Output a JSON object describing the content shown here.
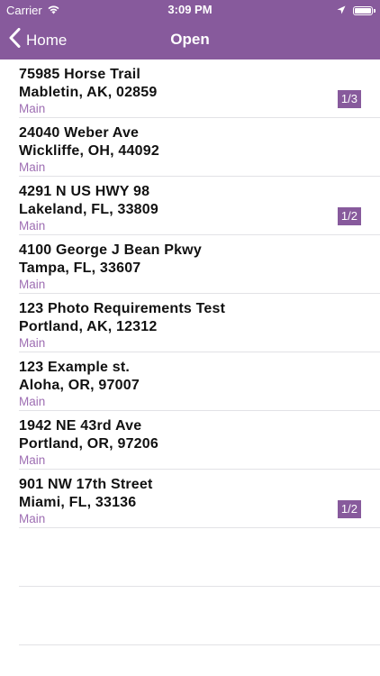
{
  "status_bar": {
    "carrier": "Carrier",
    "time": "3:09 PM",
    "wifi_icon": "wifi-icon",
    "location_icon": "location-arrow-icon",
    "battery_icon": "battery-icon",
    "battery_level": 1.0
  },
  "nav": {
    "back_label": "Home",
    "back_icon": "chevron-left-icon",
    "title": "Open"
  },
  "colors": {
    "header_bg": "#875a9c",
    "accent": "#9e6eb3",
    "badge_bg": "#875a9c"
  },
  "items": [
    {
      "line1": "75985 Horse Trail",
      "line2": "Mabletin, AK, 02859",
      "type": "Main",
      "badge": "1/3"
    },
    {
      "line1": "24040 Weber Ave",
      "line2": "Wickliffe, OH, 44092",
      "type": "Main",
      "badge": ""
    },
    {
      "line1": "4291 N US HWY 98",
      "line2": "Lakeland, FL, 33809",
      "type": "Main",
      "badge": "1/2"
    },
    {
      "line1": "4100 George J Bean Pkwy",
      "line2": "Tampa, FL, 33607",
      "type": "Main",
      "badge": ""
    },
    {
      "line1": "123 Photo Requirements Test",
      "line2": "Portland, AK, 12312",
      "type": "Main",
      "badge": ""
    },
    {
      "line1": "123 Example st.",
      "line2": "Aloha, OR, 97007",
      "type": "Main",
      "badge": ""
    },
    {
      "line1": "1942 NE 43rd Ave",
      "line2": "Portland, OR, 97206",
      "type": "Main",
      "badge": ""
    },
    {
      "line1": "901 NW 17th Street",
      "line2": "Miami, FL, 33136",
      "type": "Main",
      "badge": "1/2"
    }
  ]
}
